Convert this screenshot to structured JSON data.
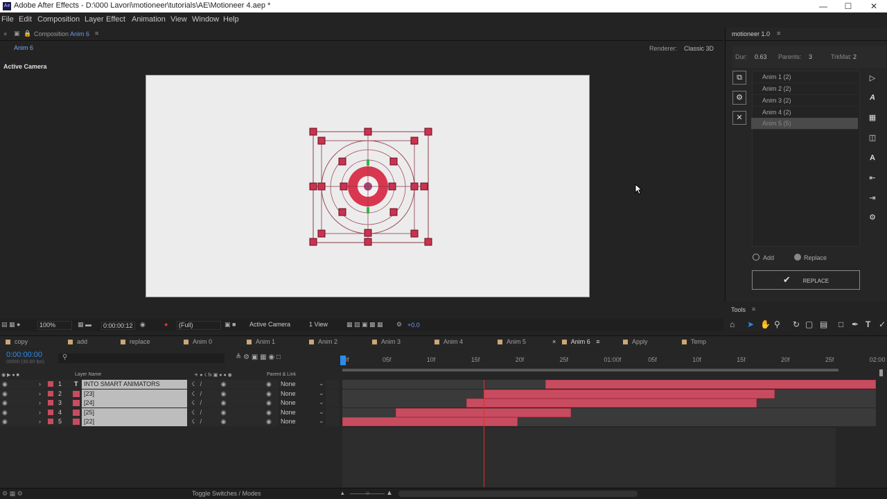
{
  "window": {
    "title": "Adobe After Effects - D:\\000 Lavori\\motioneer\\tutorials\\AE\\Motioneer 4.aep *",
    "app_icon": "Ae"
  },
  "menu": [
    "File",
    "Edit",
    "Composition",
    "Layer",
    "Effect",
    "Animation",
    "View",
    "Window",
    "Help"
  ],
  "comp_panel": {
    "tab_prefix": "Composition",
    "tab_name": "Anim 6",
    "breadcrumb": "Anim 6",
    "renderer_label": "Renderer:",
    "renderer_value": "Classic 3D",
    "camera_label": "Active Camera"
  },
  "motioneer": {
    "title": "motioneer 1.0",
    "dur_label": "Dur:",
    "dur_value": "0.63",
    "parents_label": "Parents:",
    "parents_value": "3",
    "trkmat_label": "TrkMat:",
    "trkmat_value": "2",
    "items": [
      "Anim 1 (2)",
      "Anim 2 (2)",
      "Anim 3 (2)",
      "Anim 4 (2)",
      "Anim 5 (5)"
    ],
    "selected_index": 4,
    "radio_add": "Add",
    "radio_replace": "Replace",
    "replace_button": "REPLACE"
  },
  "tools": {
    "title": "Tools"
  },
  "viewer_toolbar": {
    "zoom": "100%",
    "timecode": "0:00:00:12",
    "resolution": "(Full)",
    "camera": "Active Camera",
    "views": "1 View",
    "exposure": "+0.0"
  },
  "comp_tabs": [
    {
      "label": "copy",
      "color": "#c9a777"
    },
    {
      "label": "add",
      "color": "#c9a777"
    },
    {
      "label": "replace",
      "color": "#c9a777"
    },
    {
      "label": "Anim 0",
      "color": "#c9a777"
    },
    {
      "label": "Anim 1",
      "color": "#c9a777"
    },
    {
      "label": "Anim 2",
      "color": "#c9a777"
    },
    {
      "label": "Anim 3",
      "color": "#c9a777"
    },
    {
      "label": "Anim 4",
      "color": "#c9a777"
    },
    {
      "label": "Anim 5",
      "color": "#c9a777"
    },
    {
      "label": "Anim 6",
      "color": "#c9a777"
    },
    {
      "label": "Apply",
      "color": "#c9a777"
    },
    {
      "label": "Temp",
      "color": "#c9a777"
    }
  ],
  "timeline": {
    "current_time": "0:00:00:00",
    "fps": "00000 (30.00 fps)",
    "col_layer_name": "Layer Name",
    "col_parent": "Parent & Link",
    "ruler": [
      "0f",
      "05f",
      "10f",
      "15f",
      "20f",
      "25f",
      "01:00f",
      "05f",
      "10f",
      "15f",
      "20f",
      "25f",
      "02:00"
    ],
    "layers": [
      {
        "num": "1",
        "name": "INTO SMART ANIMATORS",
        "type": "T",
        "parent": "None",
        "start": 0.38,
        "end": 1.0
      },
      {
        "num": "2",
        "name": "[23]",
        "type": "",
        "parent": "None",
        "start": 0.265,
        "end": 0.81
      },
      {
        "num": "3",
        "name": "[24]",
        "type": "",
        "parent": "None",
        "start": 0.232,
        "end": 0.776
      },
      {
        "num": "4",
        "name": "[25]",
        "type": "",
        "parent": "None",
        "start": 0.1,
        "end": 0.428
      },
      {
        "num": "5",
        "name": "[22]",
        "type": "",
        "parent": "None",
        "start": 0.0,
        "end": 0.328
      }
    ],
    "playhead": 0.265,
    "toggle_label": "Toggle Switches / Modes"
  },
  "colors": {
    "accent_blue": "#2d8ceb",
    "layer_bar": "#c84c5f",
    "handle": "#c8344f"
  }
}
